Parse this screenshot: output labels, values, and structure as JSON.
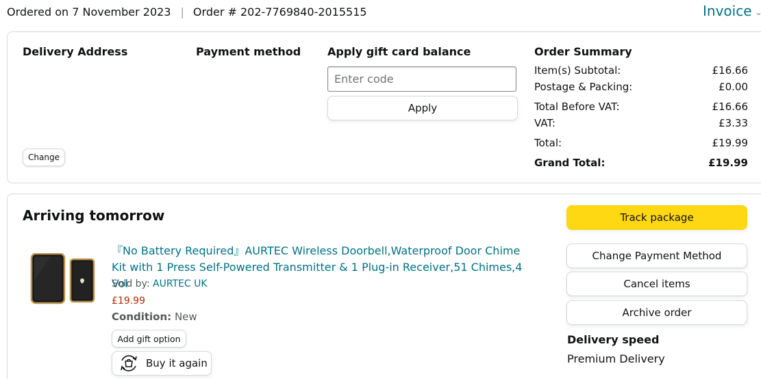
{
  "header": {
    "ordered_on": "Ordered on 7 November 2023",
    "separator": "|",
    "order_number": "Order # 202-7769840-2015515",
    "invoice_label": "Invoice"
  },
  "summary_card": {
    "delivery_address_heading": "Delivery Address",
    "change_button": "Change",
    "payment_method_heading": "Payment method",
    "gift_card": {
      "heading": "Apply gift card balance",
      "input_value": "",
      "input_placeholder": "Enter code",
      "apply_button": "Apply"
    },
    "order_summary": {
      "heading": "Order Summary",
      "rows": [
        {
          "label": "Item(s) Subtotal:",
          "value": "£16.66"
        },
        {
          "label": "Postage & Packing:",
          "value": "£0.00"
        },
        {
          "label": "Total Before VAT:",
          "value": "£16.66"
        },
        {
          "label": "VAT:",
          "value": "£3.33"
        },
        {
          "label": "Total:",
          "value": "£19.99"
        }
      ],
      "grand_total": {
        "label": "Grand Total:",
        "value": "£19.99"
      }
    }
  },
  "shipment": {
    "status": "Arriving tomorrow",
    "product": {
      "title": "『No Battery Required』AURTEC Wireless Doorbell,Waterproof Door Chime Kit with 1 Press Self-Powered Transmitter & 1 Plug-in Receiver,51 Chimes,4 Vol",
      "sold_by_label": "Sold by: ",
      "seller": "AURTEC UK",
      "price": "£19.99",
      "condition_label": "Condition:",
      "condition_value": "New",
      "add_gift_option": "Add gift option",
      "buy_again": "Buy it again"
    },
    "actions": {
      "track_package": "Track package",
      "change_payment_method": "Change Payment Method",
      "cancel_items": "Cancel items",
      "archive_order": "Archive order"
    },
    "delivery_speed_heading": "Delivery speed",
    "delivery_speed_value": "Premium Delivery"
  },
  "colors": {
    "link": "#007185",
    "price": "#b12704",
    "track_button": "#ffd814",
    "border": "#d5d9d9"
  },
  "icons": [
    "chevron-down-icon",
    "buy-again-icon"
  ]
}
